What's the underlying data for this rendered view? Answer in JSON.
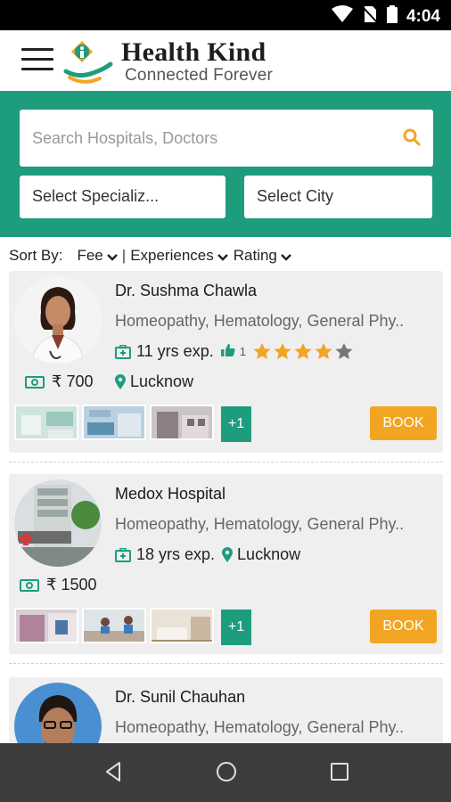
{
  "status_bar": {
    "time": "4:04"
  },
  "app_bar": {
    "title": "Health Kind",
    "subtitle": "Connected Forever"
  },
  "search": {
    "placeholder": "Search Hospitals, Doctors",
    "specialization_label": "Select Specializ...",
    "city_label": "Select City"
  },
  "sort": {
    "label": "Sort By:",
    "options": [
      "Fee",
      "Experiences",
      "Rating"
    ],
    "separator": "|"
  },
  "colors": {
    "brand_green": "#1e9c7e",
    "book_orange": "#f2a522",
    "star": "#f2a522"
  },
  "results": [
    {
      "name": "Dr. Sushma Chawla",
      "specializations": "Homeopathy, Hematology, General Phy..",
      "experience": "11 yrs exp.",
      "likes": "1",
      "rating": 4,
      "rating_max": 5,
      "location": "Lucknow",
      "fee": "₹ 700",
      "more_photos": "+1",
      "book_label": "BOOK"
    },
    {
      "name": "Medox Hospital",
      "specializations": "Homeopathy, Hematology, General Phy..",
      "experience": "18 yrs exp.",
      "location": "Lucknow",
      "fee": "₹ 1500",
      "more_photos": "+1",
      "book_label": "BOOK"
    },
    {
      "name": "Dr. Sunil Chauhan",
      "specializations": "Homeopathy, Hematology, General Phy.."
    }
  ]
}
